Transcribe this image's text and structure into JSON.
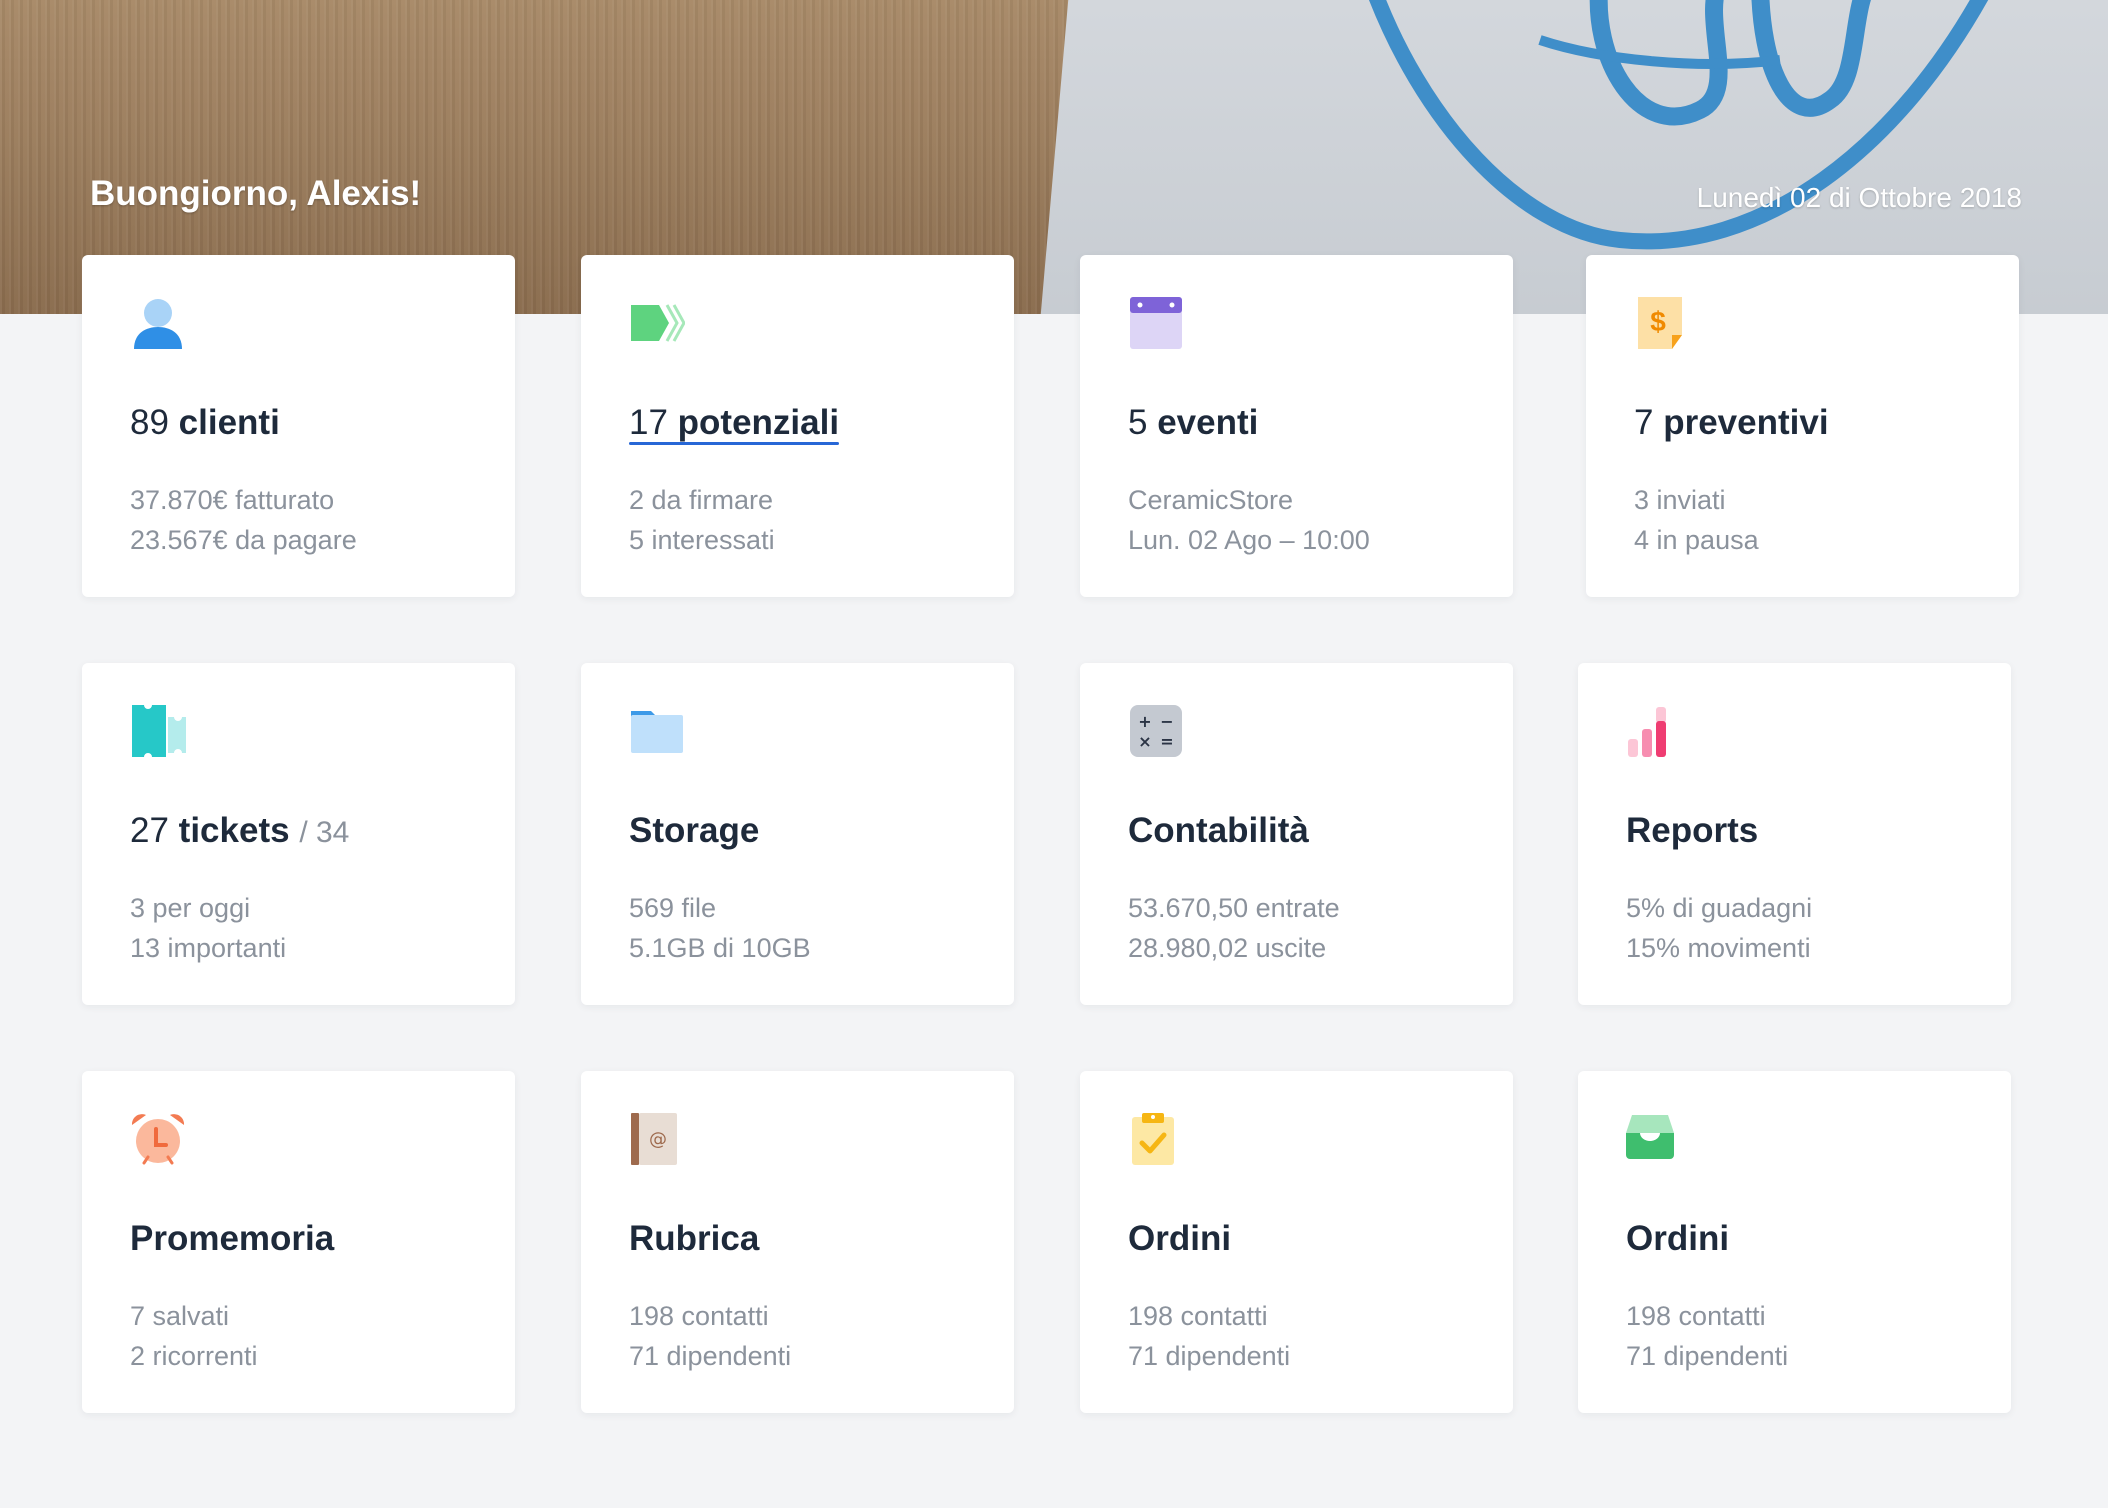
{
  "header": {
    "greeting": "Buongiorno, Alexis!",
    "date": "Lunedì 02 di Ottobre 2018"
  },
  "colors": {
    "primary_text": "#1e2a3b",
    "secondary_text": "#8b929c",
    "background": "#f3f4f6",
    "link_underline": "#2767d6"
  },
  "cards": [
    {
      "icon": "user-icon",
      "num": "89",
      "label": "clienti",
      "line1": "37.870€ fatturato",
      "line2": "23.567€ da pagare"
    },
    {
      "icon": "tag-icon",
      "num": "17",
      "label": "potenziali",
      "line1": "2 da firmare",
      "line2": "5 interessati"
    },
    {
      "icon": "calendar-icon",
      "num": "5",
      "label": "eventi",
      "line1": "CeramicStore",
      "line2": "Lun. 02 Ago – 10:00"
    },
    {
      "icon": "invoice-icon",
      "num": "7",
      "label": "preventivi",
      "line1": "3 inviati",
      "line2": "4 in pausa"
    },
    {
      "icon": "ticket-icon",
      "num": "27",
      "label": "tickets",
      "extra": "/ 34",
      "line1": "3 per oggi",
      "line2": "13 importanti"
    },
    {
      "icon": "folder-icon",
      "num": "",
      "label": "Storage",
      "line1": "569 file",
      "line2": "5.1GB di 10GB"
    },
    {
      "icon": "calculator-icon",
      "num": "",
      "label": "Contabilità",
      "line1": "53.670,50 entrate",
      "line2": "28.980,02 uscite"
    },
    {
      "icon": "bar-chart-icon",
      "num": "",
      "label": "Reports",
      "line1": "5% di guadagni",
      "line2": "15% movimenti"
    },
    {
      "icon": "alarm-clock-icon",
      "num": "",
      "label": "Promemoria",
      "line1": "7 salvati",
      "line2": "2 ricorrenti"
    },
    {
      "icon": "address-book-icon",
      "num": "",
      "label": "Rubrica",
      "line1": "198 contatti",
      "line2": "71 dipendenti"
    },
    {
      "icon": "clipboard-check-icon",
      "num": "",
      "label": "Ordini",
      "line1": "198 contatti",
      "line2": "71 dipendenti"
    },
    {
      "icon": "inbox-tray-icon",
      "num": "",
      "label": "Ordini",
      "line1": "198 contatti",
      "line2": "71 dipendenti"
    }
  ]
}
